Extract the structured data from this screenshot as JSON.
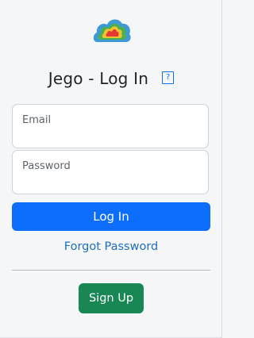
{
  "app": {
    "name": "Jego",
    "logo_icon": "cloud-rainbow-logo"
  },
  "header": {
    "title": "Jego - Log In",
    "help_icon_text": "?"
  },
  "form": {
    "email": {
      "label": "Email",
      "value": ""
    },
    "password": {
      "label": "Password",
      "value": ""
    },
    "login_label": "Log In",
    "forgot_label": "Forgot Password",
    "signup_label": "Sign Up"
  },
  "colors": {
    "primary": "#0d6efd",
    "success": "#198754",
    "link": "#1f6fbf",
    "background": "#f5f6f8"
  }
}
